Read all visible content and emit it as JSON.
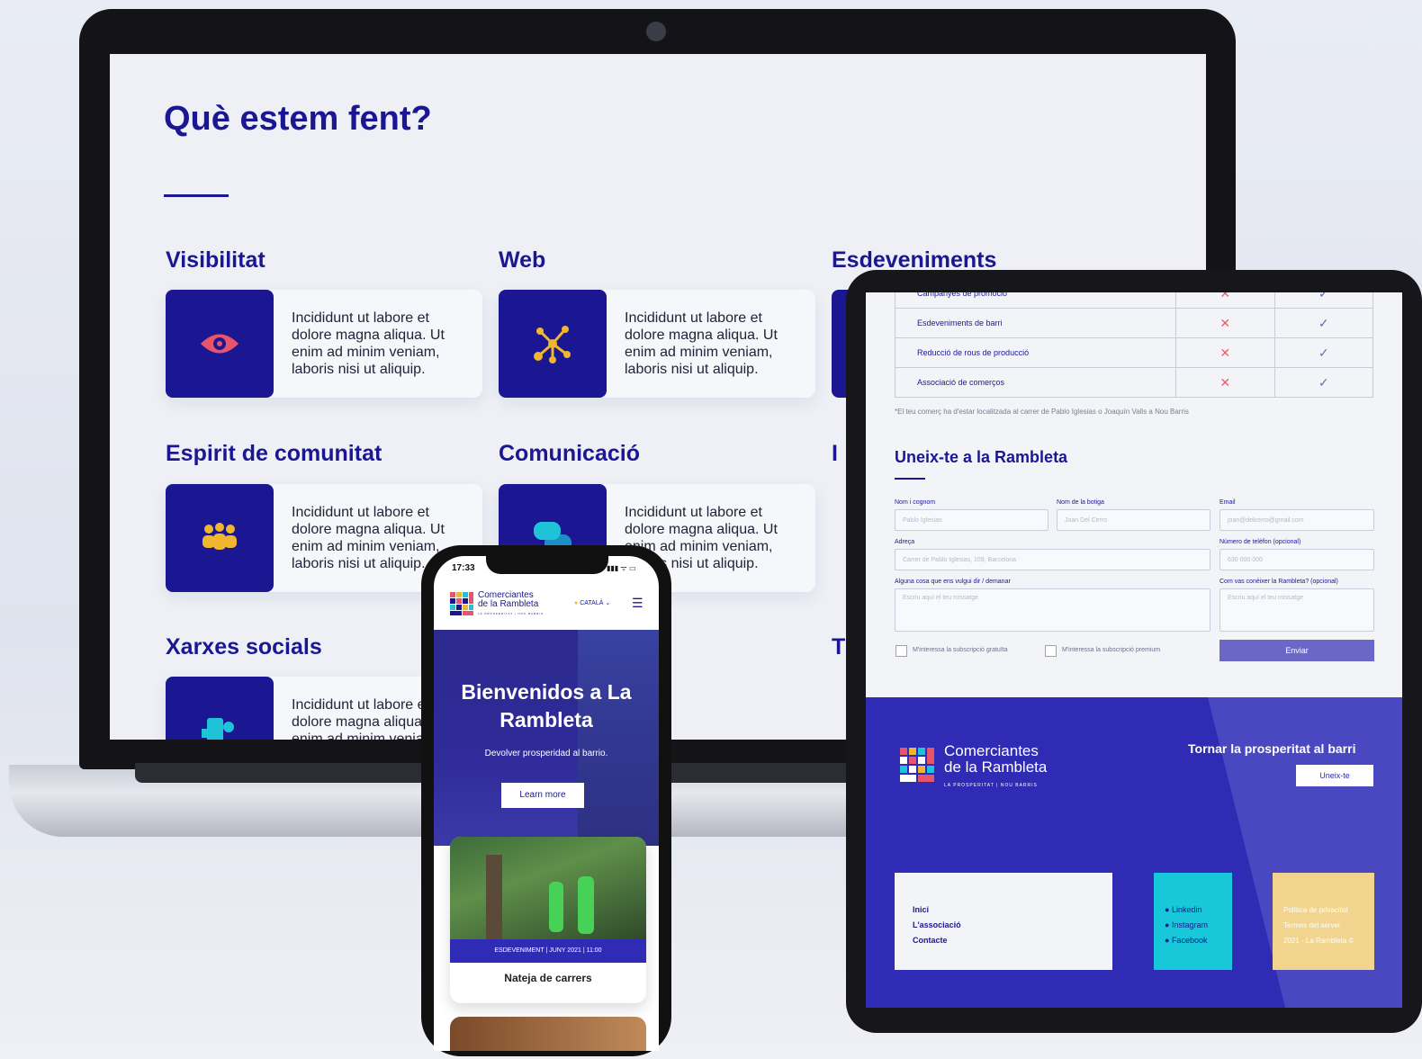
{
  "laptop": {
    "title": "Què estem fent?",
    "services": [
      {
        "title": "Visibilitat",
        "icon": "eye-icon",
        "text": "Incididunt ut labore et dolore magna aliqua. Ut enim ad minim veniam, laboris nisi ut aliquip."
      },
      {
        "title": "Web",
        "icon": "network-icon",
        "text": "Incididunt ut labore et dolore magna aliqua. Ut enim ad minim veniam, laboris nisi ut aliquip."
      },
      {
        "title": "Esdeveniments",
        "icon": "calendar-icon",
        "text": ""
      },
      {
        "title": "Espirit de comunitat",
        "icon": "community-icon",
        "text": "Incididunt ut labore et dolore magna aliqua. Ut enim ad minim veniam, laboris nisi ut aliquip."
      },
      {
        "title": "Comunicació",
        "icon": "chat-icon",
        "text": "Incididunt ut labore et dolore magna aliqua. Ut enim ad minim veniam, laboris nisi ut aliquip."
      },
      {
        "title": "Xarxes socials",
        "icon": "social-icon",
        "text": "Incididunt ut labore et dolore magna aliqua. Ut enim ad minim veniam,"
      }
    ],
    "partial_headings": [
      "I",
      "T"
    ]
  },
  "tablet": {
    "table_rows": [
      {
        "label": "Campanyes de promoció",
        "basic": "✕",
        "premium": "✓"
      },
      {
        "label": "Esdeveniments de barri",
        "basic": "✕",
        "premium": "✓"
      },
      {
        "label": "Reducció de rous de producció",
        "basic": "✕",
        "premium": "✓"
      },
      {
        "label": "Associació de comerços",
        "basic": "✕",
        "premium": "✓"
      }
    ],
    "note": "*El teu comerç ha d'estar localitzada al carrer de Pablo Iglesias o Joaquín Valls a Nou Barris",
    "form_title": "Uneix-te a la Rambleta",
    "labels": {
      "name": "Nom i cognom",
      "shop": "Nom de la botiga",
      "email": "Email",
      "address": "Adreça",
      "phone": "Número de telèfon (opcional)",
      "message": "Alguna cosa que ens vulgui dir / demanar",
      "how": "Com vas conèixer la Rambleta? (opcional)"
    },
    "placeholders": {
      "name": "Pablo Iglesias",
      "shop": "Joan Del Cerro",
      "email": "joan@delcerro@gmail.com",
      "address": "Carrer de Pablo Iglesias, 109, Barcelona",
      "phone": "630 000 000",
      "message": "Escriu aquí el teu missatge",
      "how": "Escriu aquí el teu missatge"
    },
    "check_free": "M'interessa la subscripció gratuïta",
    "check_premium": "M'interessa la subscripció premium",
    "submit": "Enviar",
    "footer": {
      "brand_line1": "Comerciantes",
      "brand_line2": "de la Rambleta",
      "brand_tagline": "LA PROSPERITAT | NOU BARRIS",
      "cta_title": "Tornar la prosperitat al barri",
      "cta_button": "Uneix-te",
      "nav": [
        "Inici",
        "L'associació",
        "Contacte"
      ],
      "social": [
        "Linkedin",
        "Instagram",
        "Facebook"
      ],
      "legal": [
        "Política de privacitat",
        "Termes del servei",
        "2021 - La Rambleta ©"
      ],
      "colors": {
        "footer": "#2f2bb5",
        "social_card": "#18c7d8",
        "legal_card": "#f1d58e"
      }
    }
  },
  "phone": {
    "time": "17:33",
    "status": "▮▮▮ ᯤ ▭",
    "brand_line1": "Comerciantes",
    "brand_line2": "de la Rambleta",
    "brand_tagline": "LA PROSPERITAT | NOU BARRIS",
    "lang": "CATALÀ",
    "hero_title": "Bienvenidos a La Rambleta",
    "hero_sub": "Devolver prosperidad al barrio.",
    "hero_button": "Learn more",
    "event_meta": "ESDEVENIMENT | JUNY 2021 | 11:00",
    "event_title": "Nateja de carrers"
  }
}
